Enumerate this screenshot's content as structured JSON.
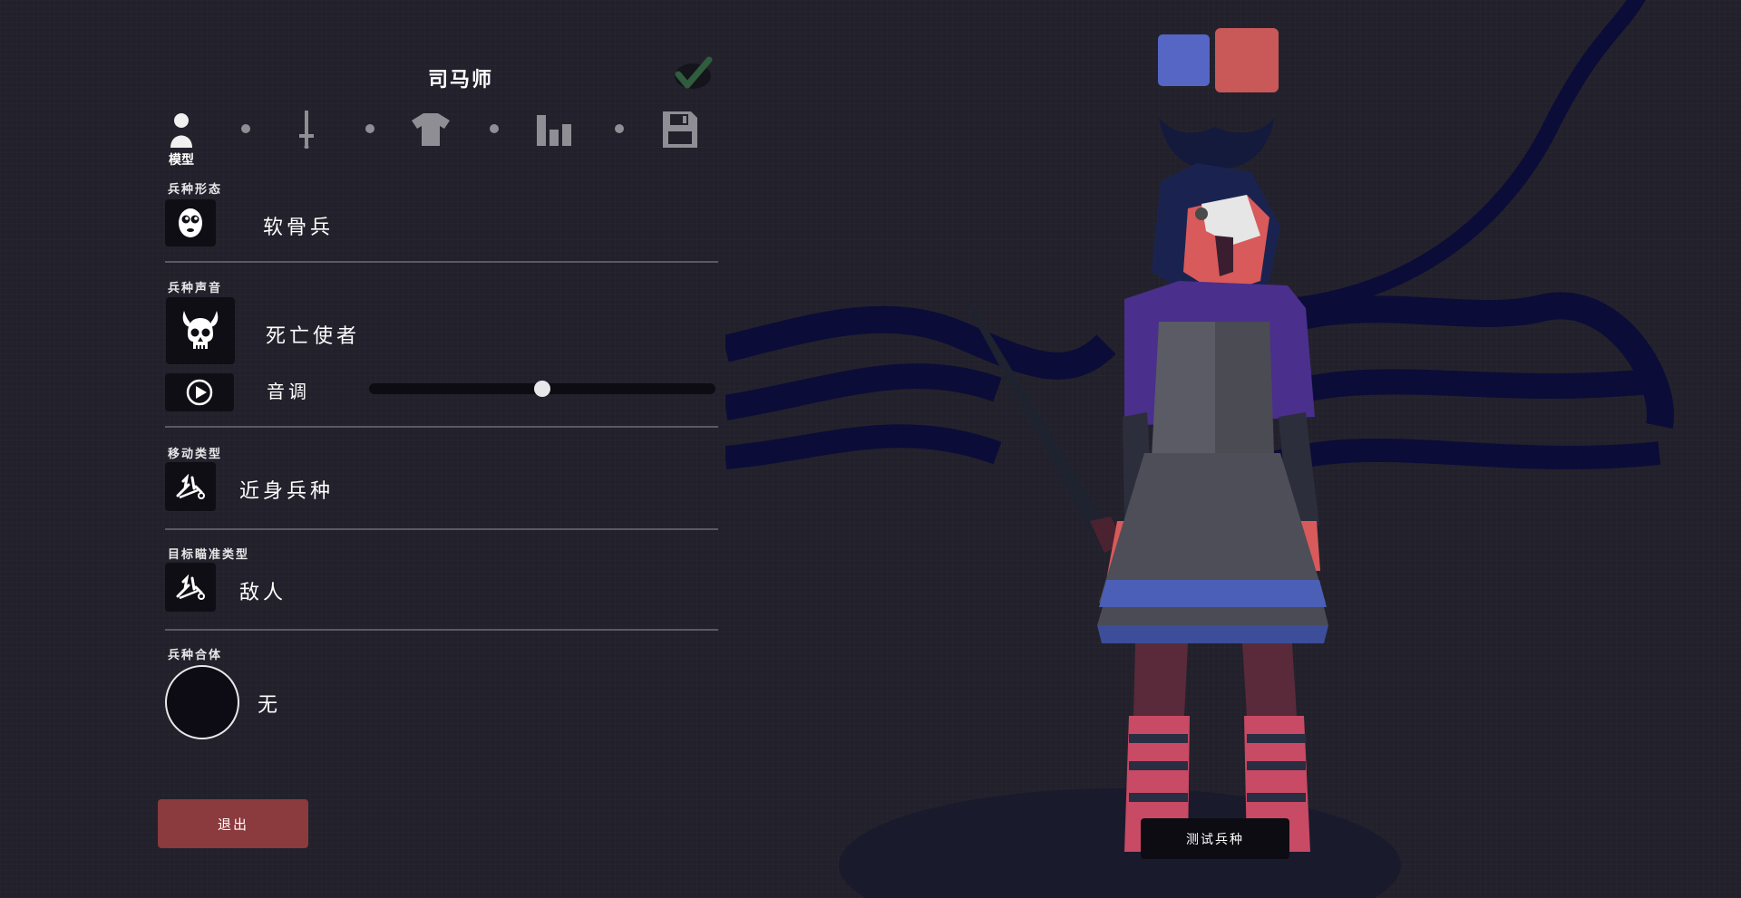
{
  "unit_name": "司马师",
  "steps": [
    {
      "label": "模型",
      "icon": "person-icon",
      "active": true
    },
    {
      "icon": "sword-icon"
    },
    {
      "icon": "shirt-icon"
    },
    {
      "icon": "bar-chart-icon"
    },
    {
      "icon": "save-icon"
    }
  ],
  "form": {
    "label": "兵种形态",
    "value": "软骨兵",
    "icon": "wobbly-face-icon"
  },
  "voice": {
    "label": "兵种声音",
    "value": "死亡使者",
    "icon": "horned-skull-icon",
    "pitch_label": "音调",
    "pitch_value": 0.5,
    "play_icon": "play-icon"
  },
  "movement": {
    "label": "移动类型",
    "value": "近身兵种",
    "icon": "melee-unit-icon"
  },
  "targeting": {
    "label": "目标瞄准类型",
    "value": "敌人",
    "icon": "target-unit-icon"
  },
  "mount": {
    "label": "兵种合体",
    "value": "无"
  },
  "exit_label": "退出",
  "test_label": "测试兵种",
  "colors": {
    "background": "#22212b",
    "team_blue": "#5566c4",
    "team_red": "#c95858",
    "exit_button": "#8b3a3d",
    "check": "#2f5d3e"
  }
}
